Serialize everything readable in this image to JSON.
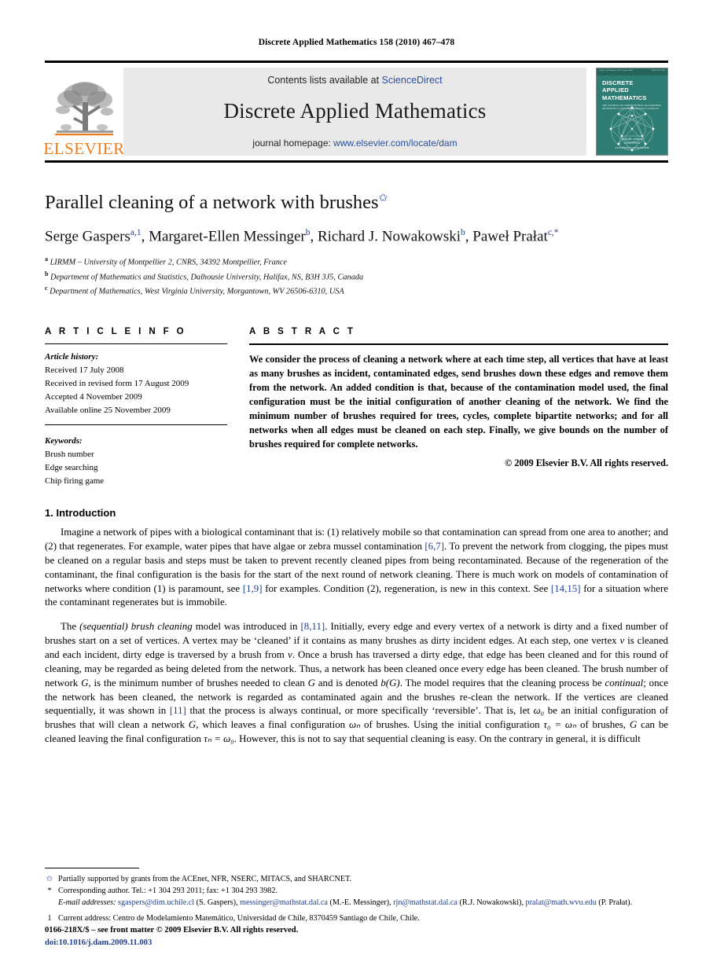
{
  "running_head": "Discrete Applied Mathematics 158 (2010) 467–478",
  "masthead": {
    "contents_prefix": "Contents lists available at",
    "contents_link": "ScienceDirect",
    "journal_title": "Discrete Applied Mathematics",
    "homepage_prefix": "journal homepage:",
    "homepage_link": "www.elsevier.com/locate/dam",
    "publisher_name": "ELSEVIER",
    "cover": {
      "top_left": "Volume 158  Number 5  15 December 2009",
      "top_right": "ISSN 0166-218X",
      "title_line1": "DISCRETE",
      "title_line2": "APPLIED",
      "title_line3": "MATHEMATICS",
      "subtitle": "THE JOURNAL OF COMBINATORIAL ALGORITHMS, INFORMATICS AND COMPUTATIONAL SCIENCES",
      "foot_line1": "Available online at",
      "foot_line2": "ScienceDirect",
      "foot_line3": "www.elsevier.com/locate/dam"
    },
    "accent_link_color": "#2b4f9c",
    "elsevier_orange": "#ef7c1b",
    "cover_teal": "#2e7d74"
  },
  "title": {
    "text": "Parallel cleaning of a network with brushes",
    "footnote_mark": "✩"
  },
  "authors": [
    {
      "name": "Serge Gaspers",
      "sup": "a,1"
    },
    {
      "name": "Margaret-Ellen Messinger",
      "sup": "b"
    },
    {
      "name": "Richard J. Nowakowski",
      "sup": "b"
    },
    {
      "name": "Paweł Prałat",
      "sup": "c,*"
    }
  ],
  "authors_line": "Serge Gaspers a,1, Margaret-Ellen Messinger b, Richard J. Nowakowski b, Paweł Prałat c,*",
  "affiliations": [
    {
      "mark": "a",
      "text": "LIRMM – University of Montpellier 2, CNRS, 34392 Montpellier, France"
    },
    {
      "mark": "b",
      "text": "Department of Mathematics and Statistics, Dalhousie University, Halifax, NS, B3H 3J5, Canada"
    },
    {
      "mark": "c",
      "text": "Department of Mathematics, West Virginia University, Morgantown, WV 26506-6310, USA"
    }
  ],
  "article_info": {
    "heading": "A R T I C L E   I N F O",
    "history_label": "Article history:",
    "history": [
      "Received 17 July 2008",
      "Received in revised form 17 August 2009",
      "Accepted 4 November 2009",
      "Available online 25 November 2009"
    ],
    "keywords_label": "Keywords:",
    "keywords": [
      "Brush number",
      "Edge searching",
      "Chip firing game"
    ]
  },
  "abstract": {
    "heading": "A B S T R A C T",
    "text": "We consider the process of cleaning a network where at each time step, all vertices that have at least as many brushes as incident, contaminated edges, send brushes down these edges and remove them from the network. An added condition is that, because of the contamination model used, the final configuration must be the initial configuration of another cleaning of the network. We find the minimum number of brushes required for trees, cycles, complete bipartite networks; and for all networks when all edges must be cleaned on each step. Finally, we give bounds on the number of brushes required for complete networks.",
    "copyright": "© 2009 Elsevier B.V. All rights reserved."
  },
  "section1": {
    "title": "1. Introduction",
    "p1_part1": "Imagine a network of pipes with a biological contaminant that is: (1) relatively mobile so that contamination can spread from one area to another; and (2) that regenerates. For example, water pipes that have algae or zebra mussel contamination ",
    "p1_cite1": "[6,7]",
    "p1_part2": ". To prevent the network from clogging, the pipes must be cleaned on a regular basis and steps must be taken to prevent recently cleaned pipes from being recontaminated. Because of the regeneration of the contaminant, the final configuration is the basis for the start of the next round of network cleaning. There is much work on models of contamination of networks where condition (1) is paramount, see ",
    "p1_cite2": "[1,9]",
    "p1_part3": " for examples. Condition (2), regeneration, is new in this context. See ",
    "p1_cite3": "[14,15]",
    "p1_part4": " for a situation where the contaminant regenerates but is immobile.",
    "p2_part1": "The ",
    "p2_italic1": "(sequential) brush cleaning",
    "p2_part2": " model was introduced in ",
    "p2_cite1": "[8,11]",
    "p2_part3": ". Initially, every edge and every vertex of a network is dirty and a fixed number of brushes start on a set of vertices. A vertex may be ‘cleaned’ if it contains as many brushes as dirty incident edges. At each step, one vertex ",
    "p2_math1": "v",
    "p2_part4": " is cleaned and each incident, dirty edge is traversed by a brush from ",
    "p2_math2": "v",
    "p2_part5": ". Once a brush has traversed a dirty edge, that edge has been cleaned and for this round of cleaning, may be regarded as being deleted from the network. Thus, a network has been cleaned once every edge has been cleaned. The brush number of network ",
    "p2_math3": "G",
    "p2_part6": ", is the minimum number of brushes needed to clean ",
    "p2_math4": "G",
    "p2_part7": " and is denoted ",
    "p2_math5": "b(G)",
    "p2_part8": ". The model requires that the cleaning process be ",
    "p2_italic2": "continual",
    "p2_part9": "; once the network has been cleaned, the network is regarded as contaminated again and the brushes re-clean the network. If the vertices are cleaned sequentially, it was shown in ",
    "p2_cite2": "[11]",
    "p2_part10": " that the process is always continual, or more specifically ‘reversible’. That is, let ",
    "p2_math6": "ω₀",
    "p2_part11": " be an initial configuration of brushes that will clean a network ",
    "p2_math7": "G",
    "p2_part12": ", which leaves a final configuration ",
    "p2_math8": "ωₙ",
    "p2_part13": " of brushes. Using the initial configuration ",
    "p2_math9": "τ₀ = ωₙ",
    "p2_part14": " of brushes, ",
    "p2_math10": "G",
    "p2_part15": " can be cleaned leaving the final configuration ",
    "p2_math11": "τₙ = ω₀",
    "p2_part16": ". However, this is not to say that sequential cleaning is easy. On the contrary in general, it is difficult"
  },
  "footnotes": [
    {
      "mark": "✩",
      "text": "Partially supported by grants from the ACEnet, NFR, NSERC, MITACS, and SHARCNET."
    },
    {
      "mark": "*",
      "text": "Corresponding author. Tel.: +1 304 293 2011; fax: +1 304 293 3982."
    }
  ],
  "emails": {
    "label": "E-mail addresses:",
    "entries": [
      {
        "address": "sgaspers@dim.uchile.cl",
        "person": "(S. Gaspers)"
      },
      {
        "address": "messinger@mathstat.dal.ca",
        "person": "(M.-E. Messinger)"
      },
      {
        "address": "rjn@mathstat.dal.ca",
        "person": "(R.J. Nowakowski)"
      },
      {
        "address": "pralat@math.wvu.edu",
        "person": "(P. Prałat)"
      }
    ]
  },
  "current_address": {
    "mark": "1",
    "text": "Current address: Centro de Modelamiento Matemático, Universidad de Chile, 8370459 Santiago de Chile, Chile."
  },
  "footer": {
    "issn_line": "0166-218X/$ – see front matter © 2009 Elsevier B.V. All rights reserved.",
    "doi_line": "doi:10.1016/j.dam.2009.11.003"
  }
}
